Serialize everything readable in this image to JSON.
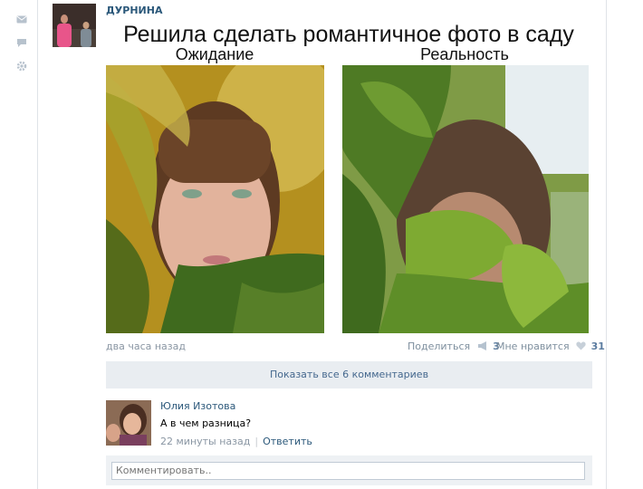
{
  "post": {
    "author": "ДУРНИНА",
    "title": "Решила сделать романтичное фото в саду",
    "label_expectation": "Ожидание",
    "label_reality": "Реальность",
    "time": "два часа назад",
    "share_label": "Поделиться",
    "share_count": "3",
    "like_label": "Мне нравится",
    "like_count": "31"
  },
  "comments": {
    "show_all": "Показать все 6 комментариев",
    "items": [
      {
        "name": "Юлия Изотова",
        "text": "А в чем разница?",
        "time": "22 минуты назад",
        "reply": "Ответить"
      }
    ],
    "input_placeholder": "Комментировать.."
  },
  "colors": {
    "link": "#2b587a",
    "meta": "#8a96a3",
    "panel": "#e9edf1"
  }
}
